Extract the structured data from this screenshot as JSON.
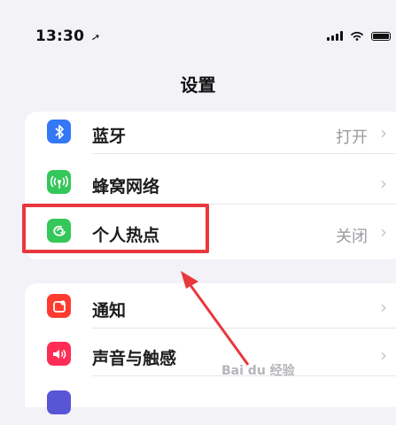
{
  "status": {
    "time": "13:30",
    "location_icon": "location-arrow-icon"
  },
  "title": "设置",
  "group1": [
    {
      "label": "蓝牙",
      "value": "打开",
      "icon": "bluetooth-icon",
      "color": "#3478f6"
    },
    {
      "label": "蜂窝网络",
      "value": "",
      "icon": "cellular-icon",
      "color": "#34c759"
    },
    {
      "label": "个人热点",
      "value": "关闭",
      "icon": "hotspot-icon",
      "color": "#34c759"
    }
  ],
  "group2": [
    {
      "label": "通知",
      "value": "",
      "icon": "notification-icon",
      "color": "#ff3b30"
    },
    {
      "label": "声音与触感",
      "value": "",
      "icon": "sound-icon",
      "color": "#ff2d55"
    }
  ],
  "annotation": {
    "highlight_color": "#e8383d",
    "watermark": "Bai du 经验"
  }
}
